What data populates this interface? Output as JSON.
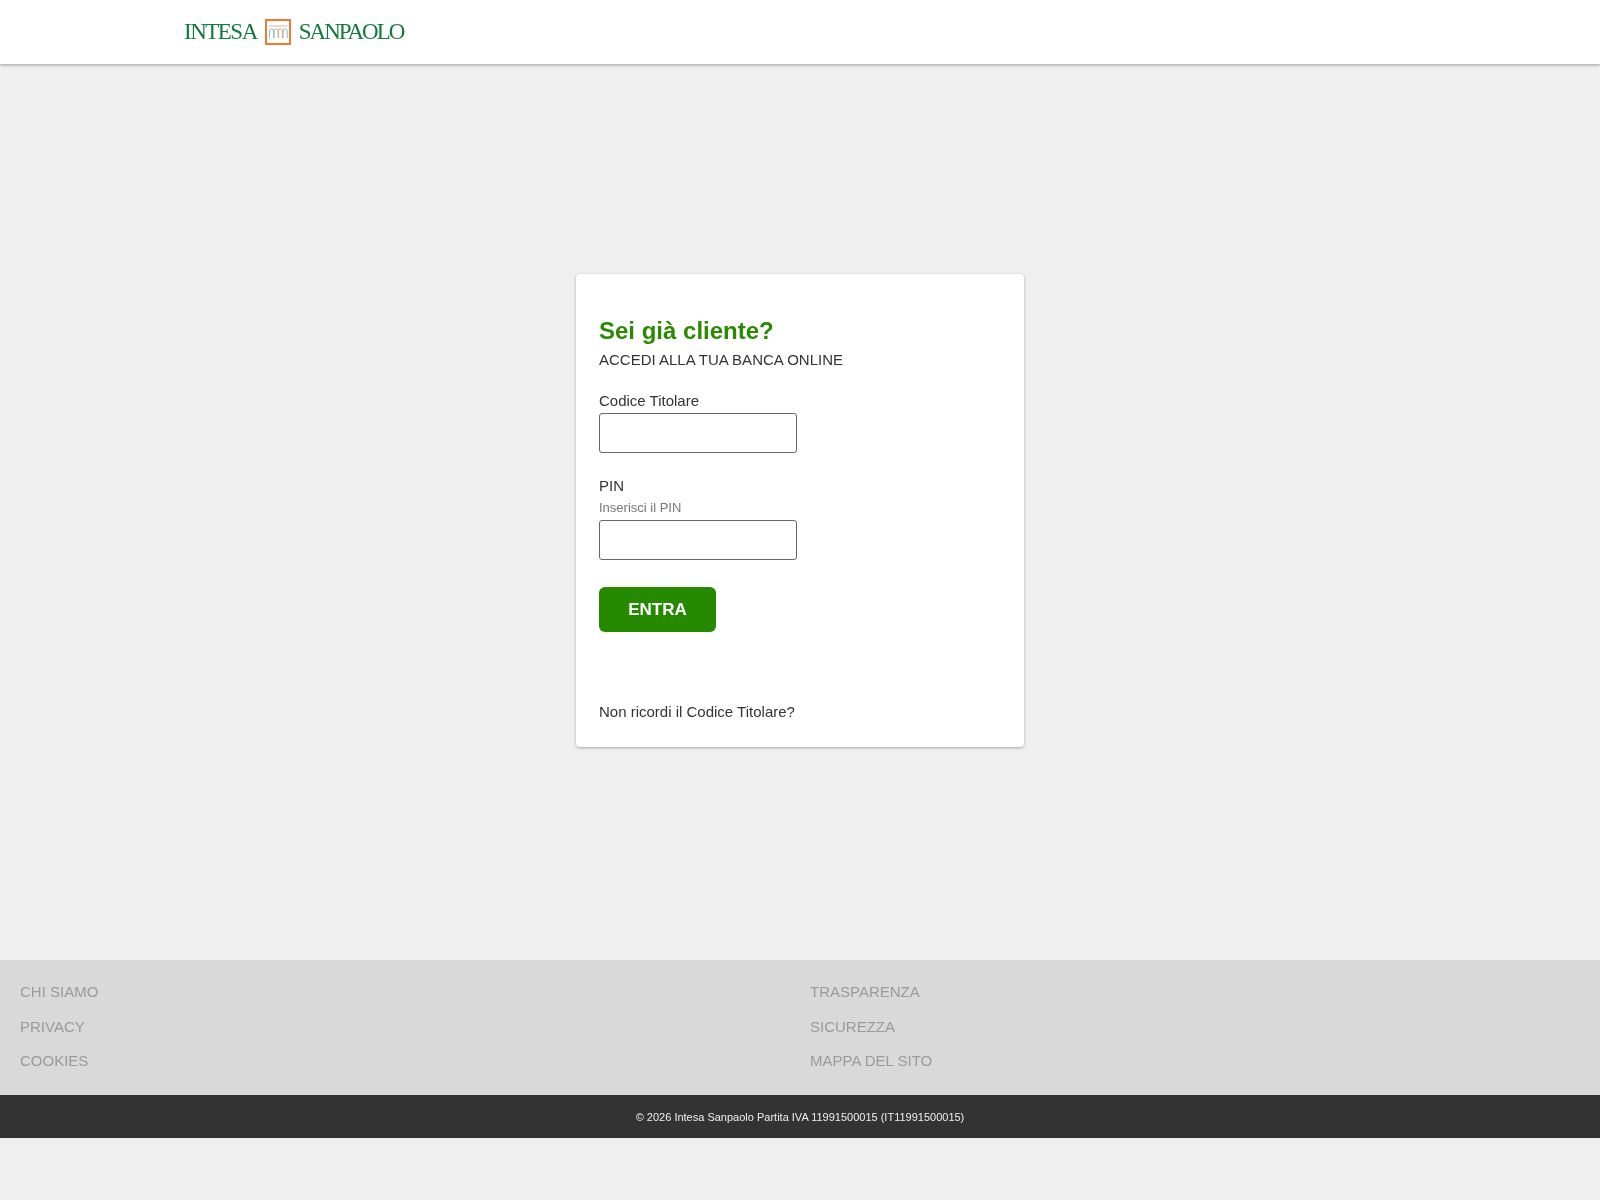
{
  "header": {
    "logo": {
      "left": "INTESA",
      "right": "SANPAOLO"
    }
  },
  "login": {
    "title": "Sei già cliente?",
    "subtitle": "ACCEDI ALLA TUA BANCA ONLINE",
    "fields": [
      {
        "label": "Codice Titolare"
      },
      {
        "label": "PIN",
        "hint": "Inserisci il PIN"
      }
    ],
    "submit": "ENTRA",
    "help_link": "Non ricordi il Codice Titolare?"
  },
  "footer": {
    "columns": [
      {
        "links": [
          "CHI SIAMO",
          "PRIVACY",
          "COOKIES"
        ]
      },
      {
        "links": [
          "TRASPARENZA",
          "SICUREZZA",
          "MAPPA DEL SITO"
        ]
      }
    ],
    "copyright": "© 2026 Intesa Sanpaolo Partita IVA 11991500015 (IT11991500015)"
  }
}
